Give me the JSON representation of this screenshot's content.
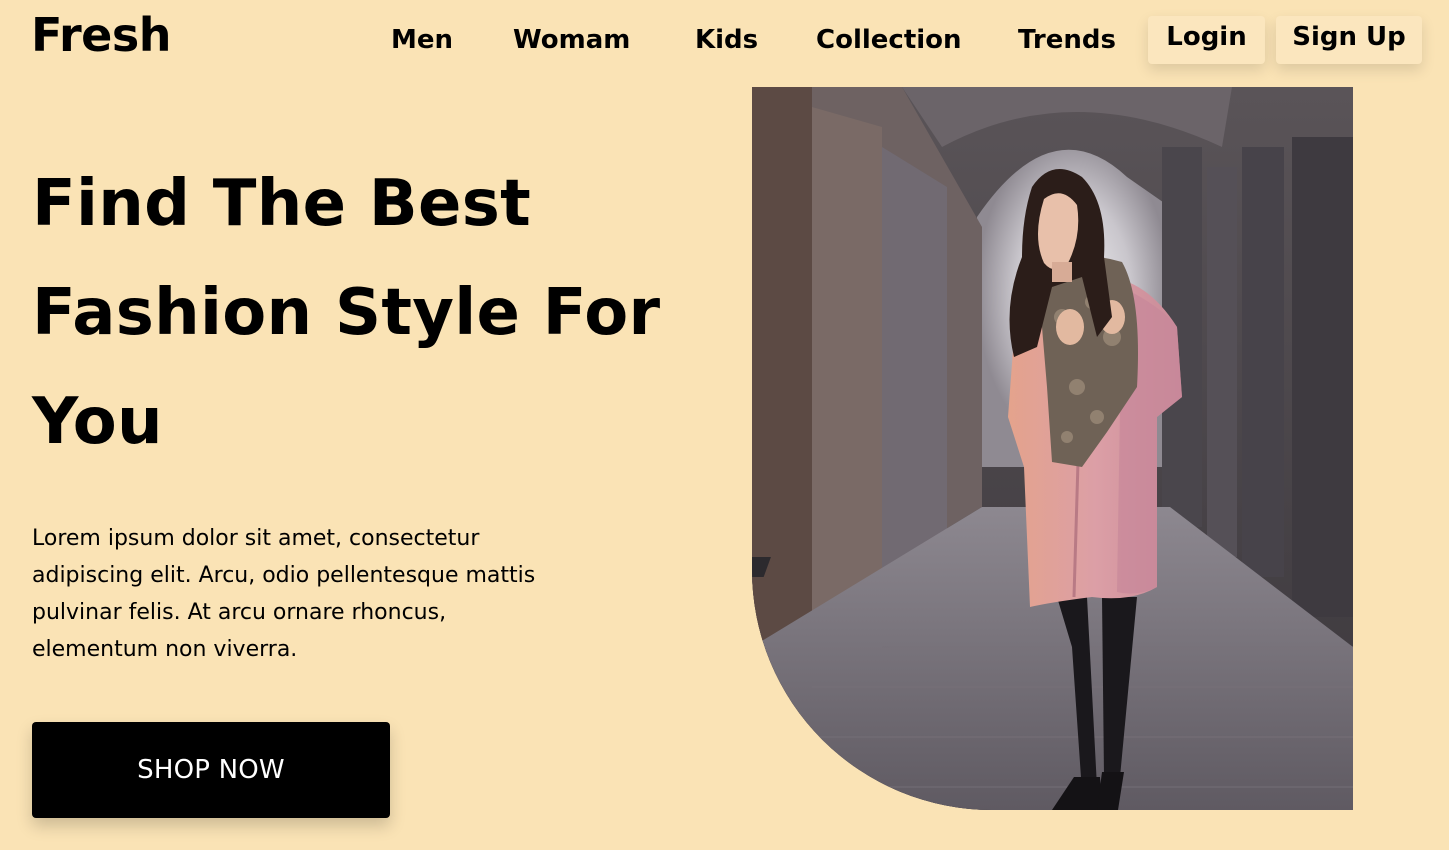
{
  "brand": {
    "logo": "Fresh"
  },
  "nav": {
    "items": [
      "Men",
      "Womam",
      "Kids",
      "Collection",
      "Trends"
    ],
    "login_label": "Login",
    "signup_label": "Sign Up"
  },
  "hero": {
    "title_lines": [
      "Find The Best",
      "Fashion Style For",
      "You"
    ],
    "description": "Lorem ipsum dolor sit amet, consectetur adipiscing elit. Arcu, odio pellentesque mattis pulvinar felis. At arcu ornare rhoncus, elementum non viverra.",
    "cta_label": "SHOP NOW"
  },
  "colors": {
    "background": "#fae3b5",
    "button_bg": "#000000",
    "button_text": "#ffffff",
    "coat": "#e5a6a8"
  }
}
